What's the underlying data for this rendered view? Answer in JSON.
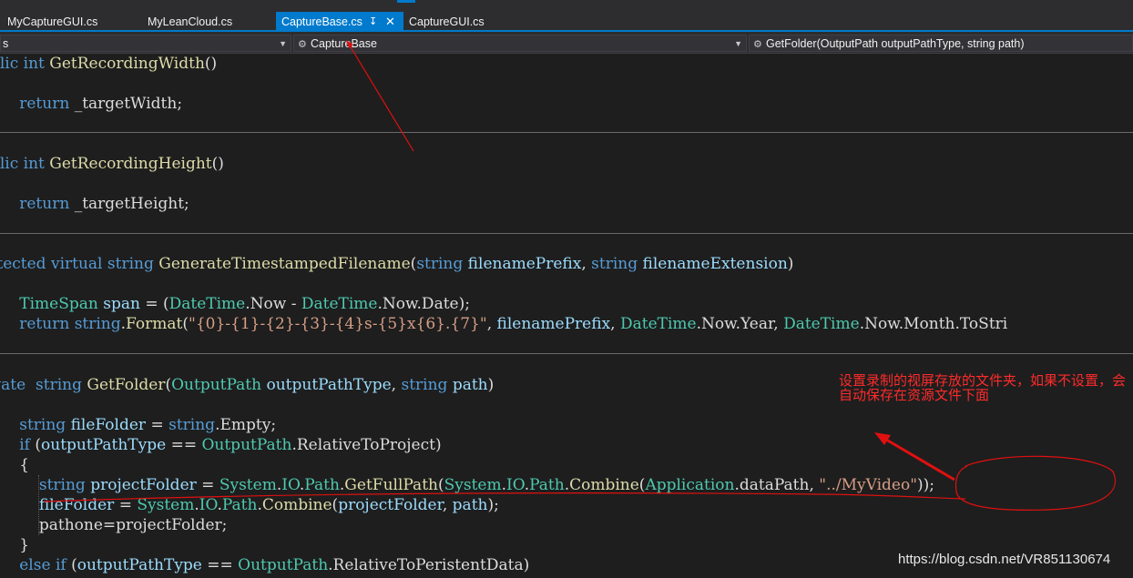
{
  "tabs": [
    {
      "label": "MyCaptureGUI.cs",
      "active": false
    },
    {
      "label": "MyLeanCloud.cs",
      "active": false
    },
    {
      "label": "CaptureBase.cs",
      "active": true
    },
    {
      "label": "CaptureGUI.cs",
      "active": false
    }
  ],
  "tab_icons": {
    "pin": "↧",
    "close": "✕"
  },
  "navbar": {
    "project": "s",
    "class": "CaptureBase",
    "member": "GetFolder(OutputPath outputPathType, string path)"
  },
  "code": {
    "l1": [
      "ublic",
      "int",
      "GetRecordingWidth",
      "()"
    ],
    "l3": [
      "return",
      "_targetWidth;"
    ],
    "l6": [
      "ublic",
      "int",
      "GetRecordingHeight",
      "()"
    ],
    "l8": [
      "return",
      "_targetHeight;"
    ],
    "l11": [
      "rotected",
      "virtual",
      "string",
      "GenerateTimestampedFilename",
      "(",
      "string",
      "filenamePrefix",
      ",",
      "string",
      "filenameExtension",
      ")"
    ],
    "l13": [
      "TimeSpan",
      "span",
      " = (",
      "DateTime",
      ".Now - ",
      "DateTime",
      ".Now.Date);"
    ],
    "l14": [
      "return",
      "string",
      ".",
      "Format",
      "(",
      "\"{0}-{1}-{2}-{3}-{4}s-{5}x{6}.{7}\"",
      ", ",
      "filenamePrefix",
      ", ",
      "DateTime",
      ".Now.Year, ",
      "DateTime",
      ".Now.Month.ToStri"
    ],
    "l17": [
      "rivate",
      "string",
      "GetFolder",
      "(",
      "OutputPath",
      "outputPathType",
      ",",
      "string",
      "path",
      ")"
    ],
    "l19": [
      "string",
      "fileFolder",
      " = ",
      "string",
      ".Empty;"
    ],
    "l20": [
      "if",
      " (",
      "outputPathType",
      " == ",
      "OutputPath",
      ".RelativeToProject)"
    ],
    "l21": "{",
    "l22": [
      "string",
      "projectFolder",
      " = ",
      "System",
      ".",
      "IO",
      ".",
      "Path",
      ".",
      "GetFullPath",
      "(",
      "System",
      ".",
      "IO",
      ".",
      "Path",
      ".",
      "Combine",
      "(",
      "Application",
      ".dataPath, ",
      "\"../MyVideo\"",
      "));"
    ],
    "l23": [
      "fileFolder",
      " = ",
      "System",
      ".",
      "IO",
      ".",
      "Path",
      ".",
      "Combine",
      "(",
      "projectFolder",
      ", ",
      "path",
      ");"
    ],
    "l24": "pathone=projectFolder;",
    "l25": "}",
    "l26": [
      "else",
      "if",
      " (",
      "outputPathType",
      " == ",
      "OutputPath",
      ".RelativeToPeristentData)"
    ]
  },
  "annotation": {
    "text": "设置录制的视屏存放的文件夹，如果不设置，会自动保存在资源文件下面",
    "color": "#ff2a2a"
  },
  "watermark": "https://blog.csdn.net/VR851130674",
  "colors": {
    "background": "#1e1e1e",
    "keyword": "#569cd6",
    "type": "#4ec9b0",
    "method": "#dcdcaa",
    "string": "#d69d85",
    "identifier": "#9cdcfe",
    "accent": "#007acc"
  }
}
